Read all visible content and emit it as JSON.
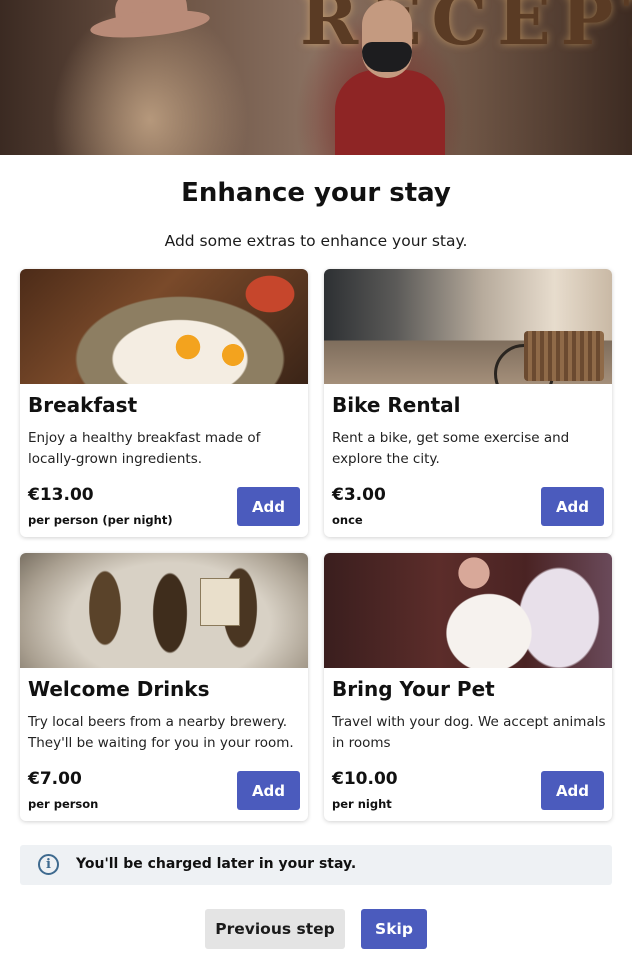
{
  "hero": {
    "sign_text": "RECEPT",
    "image": "hotel-reception-photo"
  },
  "header": {
    "title": "Enhance your stay",
    "subtitle": "Add some extras to enhance your stay."
  },
  "extras": [
    {
      "name": "Breakfast",
      "description": "Enjoy a healthy breakfast made of locally-grown ingredients.",
      "price": "€13.00",
      "unit": "per person (per night)",
      "button_label": "Add",
      "image": "breakfast-photo"
    },
    {
      "name": "Bike Rental",
      "description": "Rent a bike, get some exercise and explore the city.",
      "price": "€3.00",
      "unit": "once",
      "button_label": "Add",
      "image": "bike-photo"
    },
    {
      "name": "Welcome Drinks",
      "description": "Try local beers from a nearby brewery. They'll be waiting for you in your room.",
      "price": "€7.00",
      "unit": "per person",
      "button_label": "Add",
      "image": "beer-bottles-photo"
    },
    {
      "name": "Bring Your Pet",
      "description": "Travel with your dog. We accept animals in rooms",
      "price": "€10.00",
      "unit": "per night",
      "button_label": "Add",
      "image": "woman-with-dog-photo"
    }
  ],
  "notice": {
    "icon": "info-icon",
    "icon_glyph": "i",
    "text": "You'll be charged later in your stay."
  },
  "footer": {
    "previous_label": "Previous step",
    "skip_label": "Skip"
  },
  "colors": {
    "primary": "#4b5bbd",
    "secondary_button": "#e4e4e4",
    "notice_bg": "#eef1f4",
    "info_icon": "#3e6a8f"
  }
}
